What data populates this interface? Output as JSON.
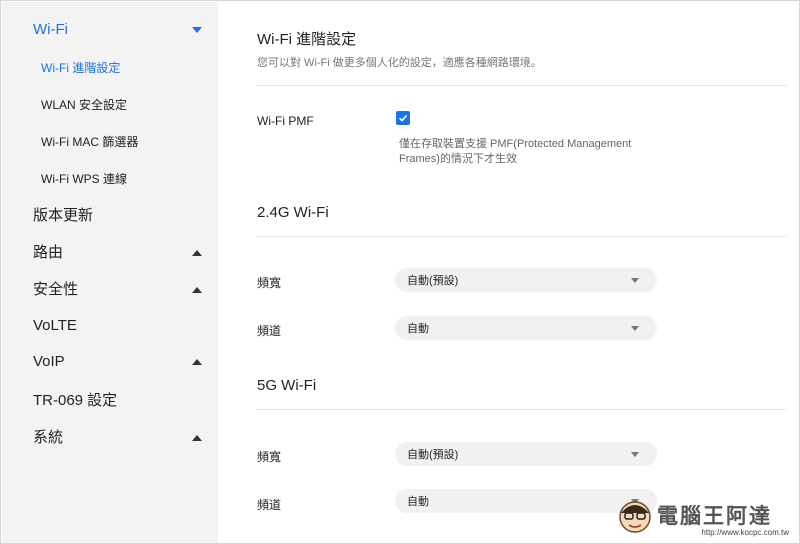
{
  "sidebar": {
    "wifi": {
      "label": "Wi-Fi",
      "expanded": true
    },
    "sub_items": [
      {
        "label": "Wi-Fi 進階設定",
        "active": true
      },
      {
        "label": "WLAN 安全設定",
        "active": false
      },
      {
        "label": "Wi-Fi MAC 篩選器",
        "active": false
      },
      {
        "label": "Wi-Fi WPS 連線",
        "active": false
      }
    ],
    "items": [
      {
        "label": "版本更新",
        "has_caret": false
      },
      {
        "label": "路由",
        "has_caret": true
      },
      {
        "label": "安全性",
        "has_caret": true
      },
      {
        "label": "VoLTE",
        "has_caret": false
      },
      {
        "label": "VoIP",
        "has_caret": true
      },
      {
        "label": "TR-069 設定",
        "has_caret": false
      },
      {
        "label": "系統",
        "has_caret": true
      }
    ]
  },
  "main": {
    "title": "Wi-Fi 進階設定",
    "description": "您可以對 Wi-Fi 做更多個人化的設定，適應各種網路環境。",
    "pmf": {
      "label": "Wi-Fi PMF",
      "checked": true,
      "hint": "僅在存取裝置支援 PMF(Protected Management Frames)的情況下才生效"
    },
    "band_24": {
      "title": "2.4G Wi-Fi",
      "bandwidth_label": "頻寬",
      "bandwidth_value": "自動(預設)",
      "channel_label": "頻道",
      "channel_value": "自動"
    },
    "band_5": {
      "title": "5G Wi-Fi",
      "bandwidth_label": "頻寬",
      "bandwidth_value": "自動(預設)",
      "channel_label": "頻道",
      "channel_value": "自動"
    }
  },
  "watermark": {
    "text": "電腦王阿達",
    "url": "http://www.kocpc.com.tw"
  },
  "colors": {
    "accent": "#1a73e8",
    "sidebar_bg": "#f3f3f3",
    "select_bg": "#f1f1f1"
  }
}
